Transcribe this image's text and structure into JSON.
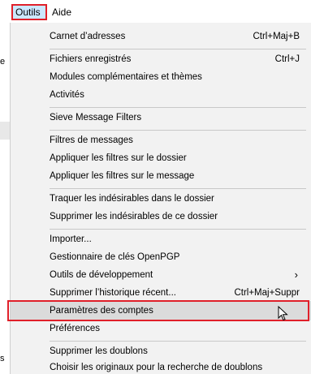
{
  "menubar": {
    "outils": "Outils",
    "aide": "Aide"
  },
  "background": {
    "fragment_e": "e",
    "fragment_s": "s"
  },
  "menu": {
    "carnet": {
      "label": "Carnet d’adresses",
      "shortcut": "Ctrl+Maj+B"
    },
    "fichiers": {
      "label": "Fichiers enregistrés",
      "shortcut": "Ctrl+J"
    },
    "modules": {
      "label": "Modules complémentaires et thèmes"
    },
    "activites": {
      "label": "Activités"
    },
    "sieve": {
      "label": "Sieve Message Filters"
    },
    "filtres": {
      "label": "Filtres de messages"
    },
    "appliquer_dossier": {
      "label": "Appliquer les filtres sur le dossier"
    },
    "appliquer_message": {
      "label": "Appliquer les filtres sur le message"
    },
    "traquer": {
      "label": "Traquer les indésirables dans le dossier"
    },
    "supprimer_indesirables": {
      "label": "Supprimer les indésirables de ce dossier"
    },
    "importer": {
      "label": "Importer..."
    },
    "openpgp": {
      "label": "Gestionnaire de clés OpenPGP"
    },
    "outils_dev": {
      "label": "Outils de développement",
      "submenu_glyph": "›"
    },
    "historique": {
      "label": "Supprimer l’historique récent...",
      "shortcut": "Ctrl+Maj+Suppr"
    },
    "parametres": {
      "label": "Paramètres des comptes"
    },
    "preferences": {
      "label": "Préférences"
    },
    "doublons": {
      "label": "Supprimer les doublons"
    },
    "originaux": {
      "label": "Choisir les originaux pour la recherche de doublons"
    }
  },
  "colors": {
    "menu_bg": "#f2f2f2",
    "highlight_bg": "#dbdbdb",
    "menubar_active_bg": "#cce8ff",
    "annotation_red": "#e0202a"
  },
  "icons": {
    "submenu": "chevron-right-icon",
    "cursor": "mouse-pointer-icon"
  }
}
